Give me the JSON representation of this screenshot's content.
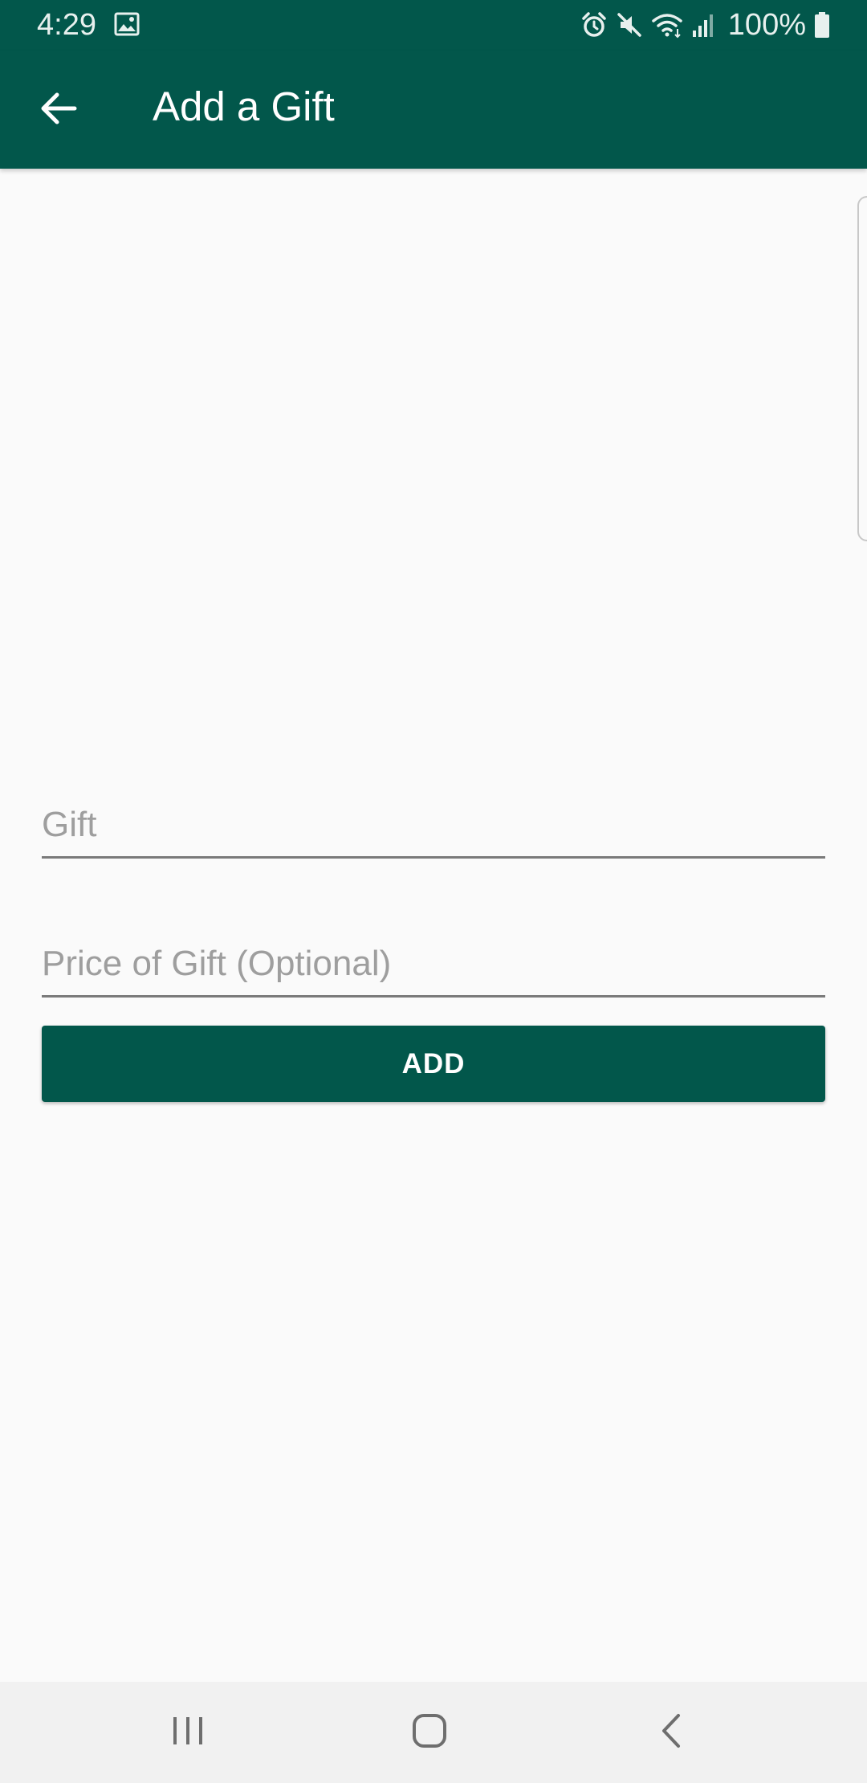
{
  "status_bar": {
    "time": "4:29",
    "battery": "100%",
    "icons": [
      "image-icon",
      "alarm-icon",
      "mute-icon",
      "wifi-icon",
      "signal-icon",
      "battery-icon"
    ]
  },
  "app_bar": {
    "title": "Add a Gift",
    "back_icon": "arrow-left-icon"
  },
  "form": {
    "gift": {
      "value": "",
      "placeholder": "Gift"
    },
    "price": {
      "value": "",
      "placeholder": "Price of Gift (Optional)"
    },
    "add_label": "ADD"
  },
  "nav_bar": {
    "icons": [
      "recent-apps-icon",
      "home-icon",
      "back-icon"
    ]
  },
  "colors": {
    "primary": "#02574b",
    "background": "#fafafa",
    "placeholder": "#9e9e9e",
    "underline": "#7a7a7a",
    "nav_background": "#f1f1f1"
  }
}
